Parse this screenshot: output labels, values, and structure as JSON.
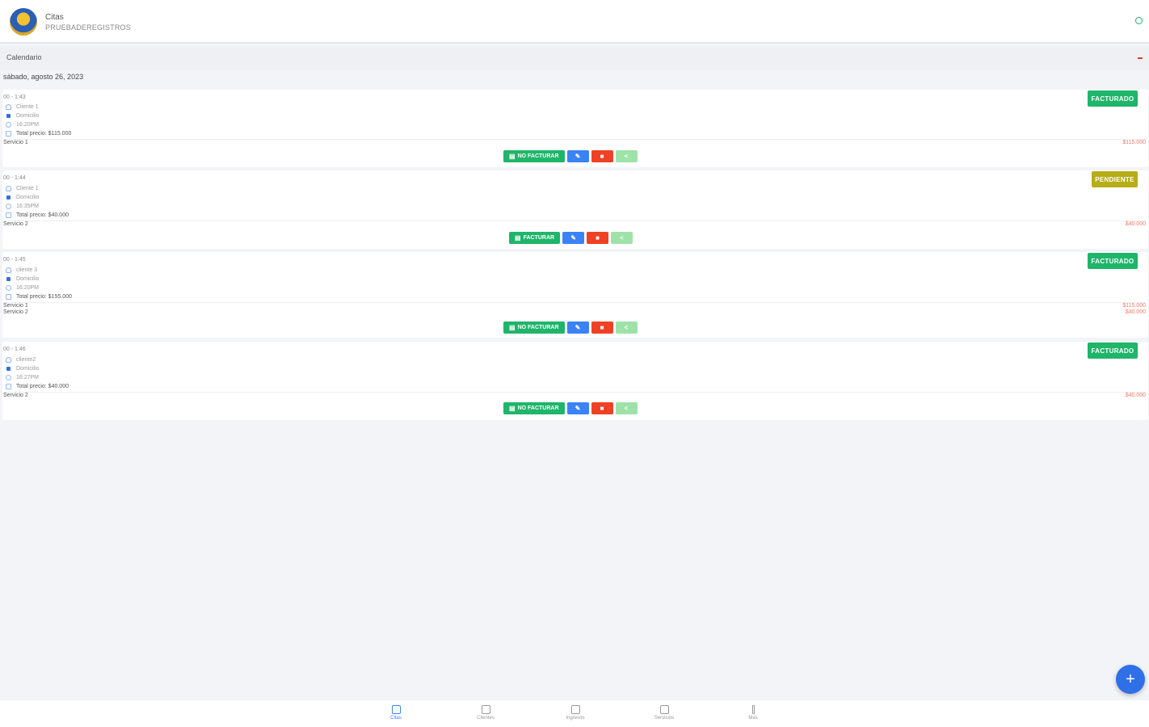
{
  "header": {
    "title": "Citas",
    "subtitle": "PRUEBADEREGISTROS"
  },
  "calendar_bar": {
    "label": "Calendario"
  },
  "date_label": "sábado, agosto 26, 2023",
  "cards": [
    {
      "title": "00 - 1:43",
      "client": "Cliente 1",
      "location": "Domicilio",
      "time": "16:20PM",
      "total": "Total precio: $115.000",
      "status": "FACTURADO",
      "status_color": "#1fb56a",
      "invoice_label": "NO FACTURAR",
      "services": [
        {
          "name": "Servicio 1",
          "price": "$115.000"
        }
      ]
    },
    {
      "title": "00 - 1:44",
      "client": "Cliente 1",
      "location": "Domicilio",
      "time": "16:35PM",
      "total": "Total precio: $40.000",
      "status": "PENDIENTE",
      "status_color": "#b7ad17",
      "invoice_label": "FACTURAR",
      "services": [
        {
          "name": "Servicio 2",
          "price": "$40.000"
        }
      ]
    },
    {
      "title": "00 - 1:45",
      "client": "cliente 3",
      "location": "Domicilio",
      "time": "16:20PM",
      "total": "Total precio: $155.000",
      "status": "FACTURADO",
      "status_color": "#1fb56a",
      "invoice_label": "NO FACTURAR",
      "services": [
        {
          "name": "Servicio 1",
          "price": "$115.000"
        },
        {
          "name": "Servicio 2",
          "price": "$40.000"
        }
      ]
    },
    {
      "title": "00 - 1:46",
      "client": "cliente2",
      "location": "Domicilio",
      "time": "16:27PM",
      "total": "Total precio: $40.000",
      "status": "FACTURADO",
      "status_color": "#1fb56a",
      "invoice_label": "NO FACTURAR",
      "services": [
        {
          "name": "Servicio 2",
          "price": "$40.000"
        }
      ]
    }
  ],
  "fab_label": "+",
  "nav": [
    {
      "label": "Citas",
      "icon": "calendar-icon",
      "active": true
    },
    {
      "label": "Clientes",
      "icon": "users-icon",
      "active": false
    },
    {
      "label": "Ingresos",
      "icon": "chart-icon",
      "active": false
    },
    {
      "label": "Servicios",
      "icon": "document-icon",
      "active": false
    },
    {
      "label": "Más",
      "icon": "more-icon",
      "active": false
    }
  ]
}
